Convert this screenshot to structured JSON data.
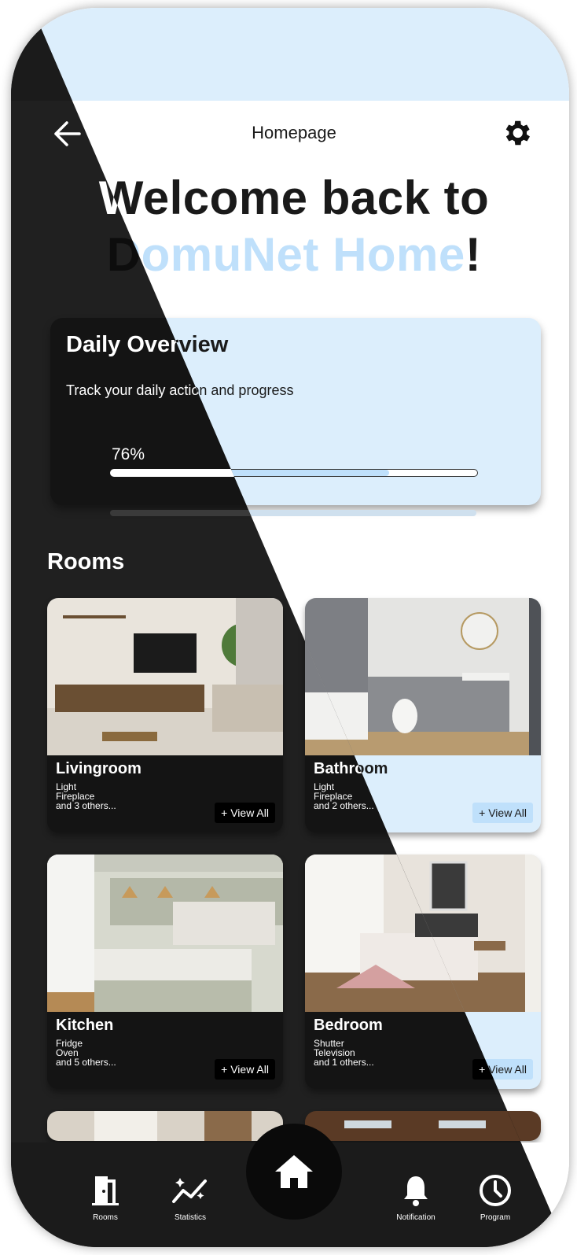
{
  "header": {
    "title": "Homepage",
    "back_icon": "arrow-left-icon",
    "settings_icon": "gear-icon"
  },
  "welcome": {
    "line1": "Welcome back to",
    "brand": "DomuNet Home",
    "suffix": "!"
  },
  "overview": {
    "title": "Daily Overview",
    "subtitle": "Track your daily action and progress",
    "progress_label": "76%",
    "progress_fraction": 0.76
  },
  "rooms": {
    "title": "Rooms",
    "view_all_label": "+ View All",
    "items": [
      {
        "name": "Livingroom",
        "devices": [
          "Light",
          "Fireplace",
          "and 3 others..."
        ]
      },
      {
        "name": "Bathroom",
        "devices": [
          "Light",
          "Fireplace",
          "and 2 others..."
        ]
      },
      {
        "name": "Kitchen",
        "devices": [
          "Fridge",
          "Oven",
          "and 5 others..."
        ]
      },
      {
        "name": "Bedroom",
        "devices": [
          "Shutter",
          "Television",
          "and 1 others..."
        ]
      }
    ]
  },
  "nav": {
    "items": [
      {
        "label": "Rooms",
        "icon": "door-icon"
      },
      {
        "label": "Statistics",
        "icon": "chart-sparkle-icon"
      },
      {
        "label": "",
        "icon": "home-icon"
      },
      {
        "label": "Notification",
        "icon": "bell-icon"
      },
      {
        "label": "Program",
        "icon": "clock-icon"
      }
    ]
  },
  "colors": {
    "accent_light_blue": "#bfe0fb",
    "panel_light_blue": "#dceefc",
    "dark_bg": "#202020",
    "dark_panel": "#141414"
  }
}
